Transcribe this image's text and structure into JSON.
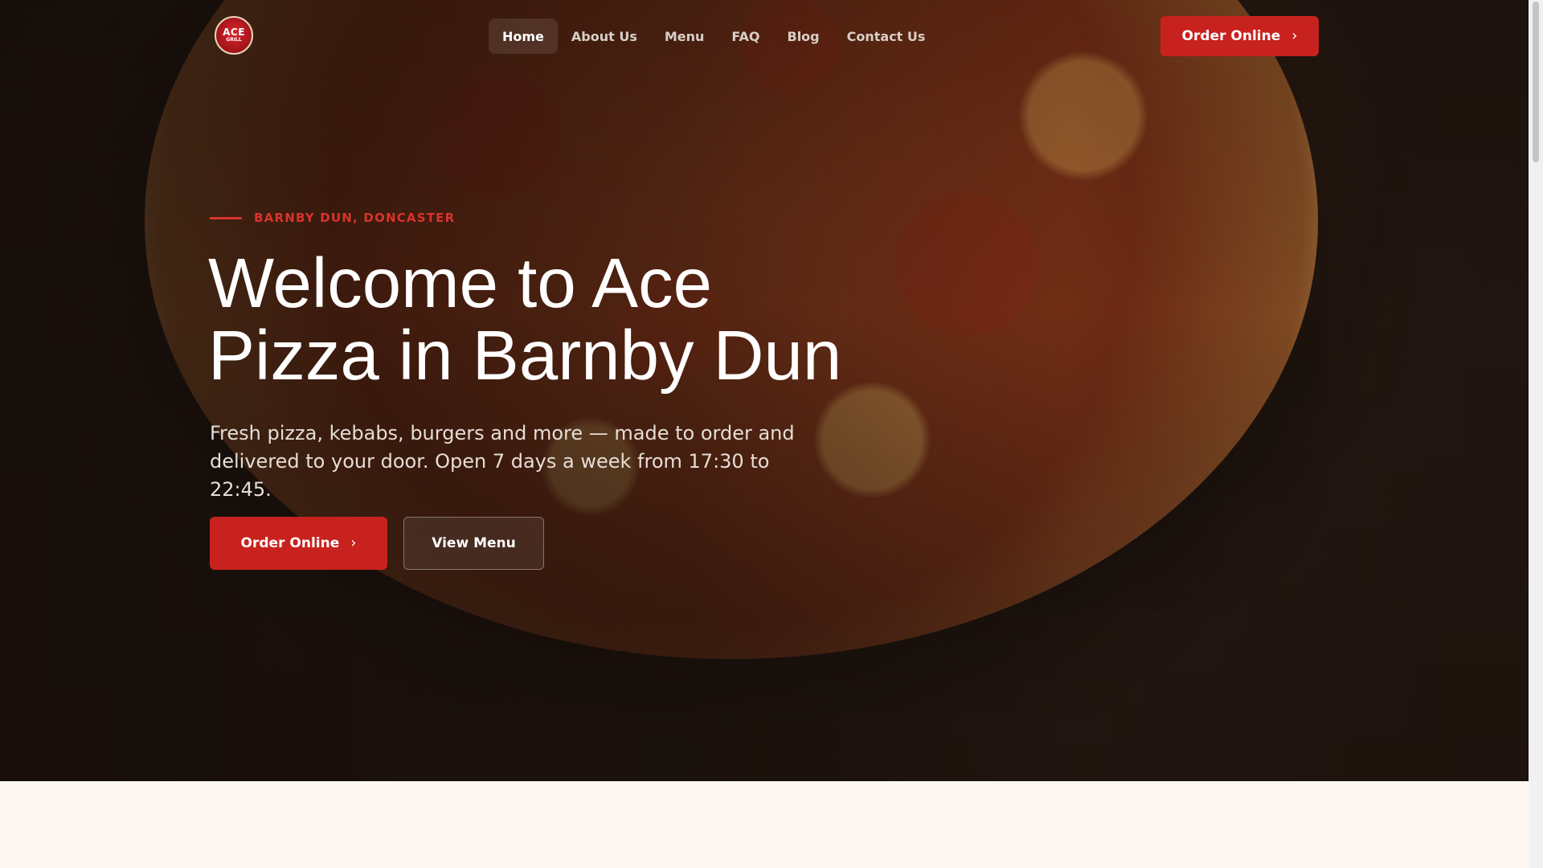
{
  "brand": {
    "logo_line1": "ACE",
    "logo_line2": "GRILL"
  },
  "nav": {
    "items": [
      {
        "label": "Home",
        "active": true
      },
      {
        "label": "About Us"
      },
      {
        "label": "Menu"
      },
      {
        "label": "FAQ"
      },
      {
        "label": "Blog"
      },
      {
        "label": "Contact Us"
      }
    ],
    "order_button": "Order Online"
  },
  "hero": {
    "eyebrow": "BARNBY DUN, DONCASTER",
    "headline_line1": "Welcome to Ace",
    "headline_line2": "Pizza in Barnby Dun",
    "subtitle": "Fresh pizza, kebabs, burgers and more — made to order and delivered to your door. Open 7 days a week from 17:30 to 22:45.",
    "primary_button": "Order Online",
    "secondary_button": "View Menu"
  },
  "icons": {
    "chevron": "chevron-right-icon",
    "chevron_glyph": "›"
  },
  "colors": {
    "accent": "#c8221f",
    "eyebrow": "#d8342c",
    "nav_text": "#d8cfc7"
  }
}
